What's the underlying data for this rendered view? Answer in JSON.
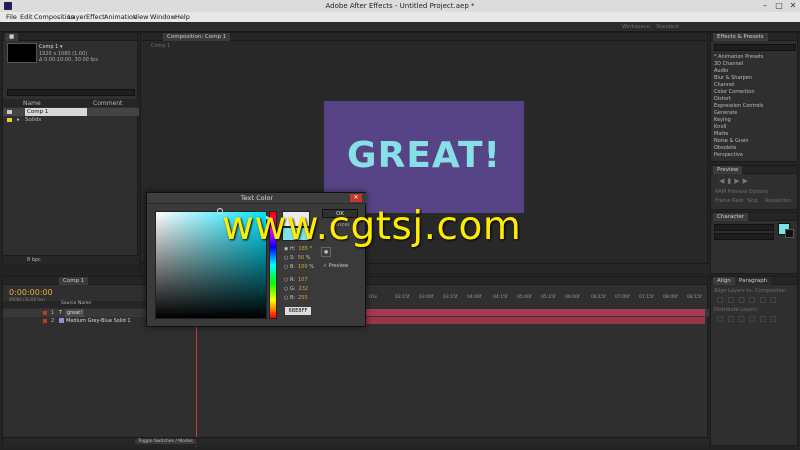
{
  "window": {
    "title": "Adobe After Effects - Untitled Project.aep *"
  },
  "menu": [
    "File",
    "Edit",
    "Composition",
    "Layer",
    "Effect",
    "Animation",
    "View",
    "Window",
    "Help"
  ],
  "workspace": {
    "label": "Workspace:",
    "value": "Standard"
  },
  "project": {
    "comp_name": "Comp 1 ▾",
    "comp_size": "1920 x 1080 (1.00)",
    "comp_duration": "Δ 0:00:10:00, 30.00 fps",
    "columns": [
      "Name",
      "Comment"
    ],
    "items": [
      {
        "name": "Comp 1"
      },
      {
        "name": "Solids"
      }
    ],
    "bpc": "8 bpc"
  },
  "viewer": {
    "tab": "Composition: Comp 1",
    "sub_tab": "Comp 1",
    "canvas_text": "GREAT!",
    "colors": {
      "canvas_bg": "#574487",
      "text": "#86e0e6"
    }
  },
  "effects_panel": {
    "tab": "Effects & Presets",
    "items": [
      "* Animation Presets",
      "3D Channel",
      "Audio",
      "Blur & Sharpen",
      "Channel",
      "Color Correction",
      "Distort",
      "Expression Controls",
      "Generate",
      "Keying",
      "Knoll",
      "Matte",
      "Noise & Grain",
      "Obsolete",
      "Perspective"
    ]
  },
  "preview_panel": {
    "tab": "Preview",
    "ram_options": "RAM Preview Options",
    "frame_rate": "Frame Rate",
    "skip": "Skip",
    "resolution": "Resolution"
  },
  "character_panel": {
    "tab": "Character",
    "swatch_color": "#7be3ea"
  },
  "paragraph_panel": {
    "tabs": [
      "Align",
      "Paragraph"
    ],
    "align_label": "Align Layers to:",
    "align_value": "Composition",
    "distribute_label": "Distribute Layers:"
  },
  "timeline": {
    "timecode": "0:00:00:00",
    "fps_note": "00000 (30.00 fps)",
    "column_source": "Source Name",
    "layers": [
      {
        "num": "1",
        "name": "great!",
        "color": "#c0392b"
      },
      {
        "num": "2",
        "name": "Medium Grey-Blue Solid 1",
        "color": "#c0392b"
      }
    ],
    "ticks": [
      "01s",
      "02:15f",
      "03:00f",
      "03:15f",
      "04:00f",
      "04:15f",
      "05:00f",
      "05:15f",
      "06:00f",
      "06:15f",
      "07:00f",
      "07:15f",
      "08:00f",
      "08:15f",
      "09:00f",
      "09:15f",
      "10:0"
    ],
    "toggle_label": "Toggle Switches / Modes"
  },
  "dialog": {
    "title": "Text Color",
    "ok": "OK",
    "cancel": "Cancel",
    "fields": [
      {
        "label": "H:",
        "value": "185",
        "unit": "°"
      },
      {
        "label": "S:",
        "value": "50",
        "unit": "%"
      },
      {
        "label": "B:",
        "value": "100",
        "unit": "%"
      },
      {
        "label": "R:",
        "value": "107",
        "unit": ""
      },
      {
        "label": "G:",
        "value": "232",
        "unit": ""
      },
      {
        "label": "B:",
        "value": "255",
        "unit": ""
      }
    ],
    "preview": "Preview",
    "hex": "6BE8FF"
  },
  "watermark": "www.cgtsj.com"
}
